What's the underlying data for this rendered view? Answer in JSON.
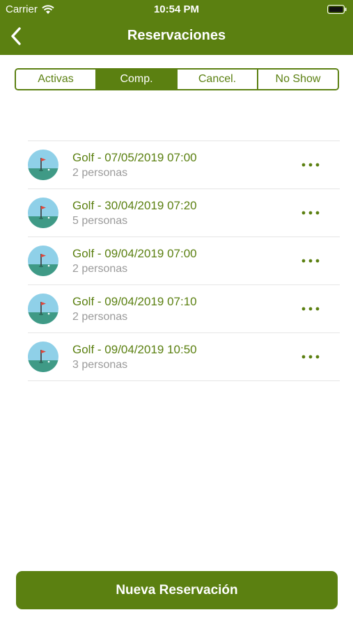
{
  "status_bar": {
    "carrier": "Carrier",
    "time": "10:54 PM"
  },
  "nav": {
    "title": "Reservaciones",
    "back_icon": "chevron-left-icon"
  },
  "tabs": [
    {
      "label": "Activas",
      "active": false
    },
    {
      "label": "Comp.",
      "active": true
    },
    {
      "label": "Cancel.",
      "active": false
    },
    {
      "label": "No Show",
      "active": false
    }
  ],
  "reservations": [
    {
      "title": "Golf - 07/05/2019 07:00",
      "subtitle": "2 personas"
    },
    {
      "title": "Golf - 30/04/2019 07:20",
      "subtitle": "5 personas"
    },
    {
      "title": "Golf - 09/04/2019 07:00",
      "subtitle": "2 personas"
    },
    {
      "title": "Golf - 09/04/2019 07:10",
      "subtitle": "2 personas"
    },
    {
      "title": "Golf - 09/04/2019 10:50",
      "subtitle": "3 personas"
    }
  ],
  "new_button": {
    "label": "Nueva Reservación"
  },
  "colors": {
    "primary": "#5b8011",
    "subtitle_gray": "#9a9a9a",
    "avatar_sky": "#8fd0e8",
    "avatar_grass": "#3f9a86",
    "flag_red": "#e0463a"
  }
}
